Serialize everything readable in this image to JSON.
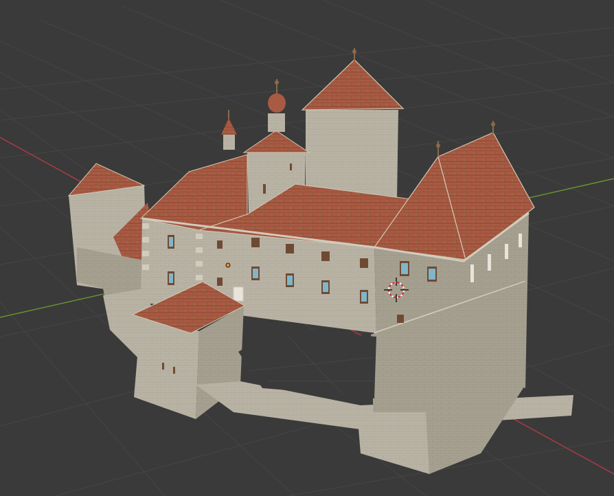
{
  "viewport": {
    "mode": "3d-viewport",
    "shading": "material-preview",
    "background_color": "#3a3a3a",
    "grid_color": "#454545",
    "x_axis_color": "#b23a48",
    "y_axis_color": "#6a9a2a"
  },
  "scene": {
    "object": "castle-model",
    "wall_color": "#b9b3a5",
    "roof_color": "#a85a43",
    "ridge_color": "#d2c8b4",
    "window_color": "#6f4a33",
    "glass_color": "#7fb7c9"
  },
  "overlays": {
    "origin_marker_color": "#f08a24",
    "cursor_3d": "3d-cursor-icon"
  }
}
